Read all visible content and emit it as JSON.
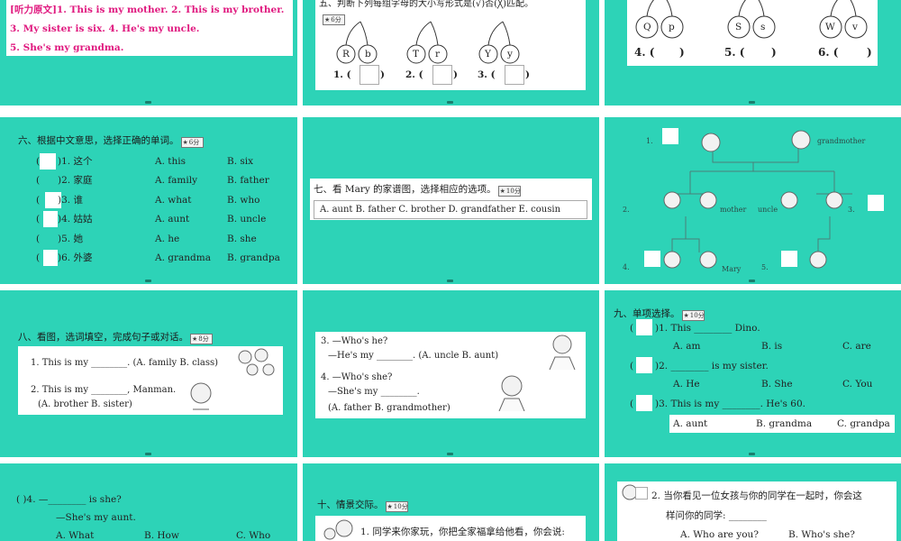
{
  "s1": {
    "lines": [
      "[听力原文]1. This is my mother.   2. This is my brother.",
      "3. My sister is six.   4. He's my uncle.",
      "5. She's my grandma."
    ]
  },
  "s2": {
    "instruction": "五、判断下列每组字母的大小写形式是(√)否(╳)匹配。",
    "badge": "6分",
    "pairs": [
      [
        "R",
        "b"
      ],
      [
        "T",
        "r"
      ],
      [
        "Y",
        "y"
      ]
    ],
    "answers": [
      "1. (",
      "2. (",
      "3. ("
    ],
    "close": ")"
  },
  "s3": {
    "pairs": [
      [
        "Q",
        "p"
      ],
      [
        "S",
        "s"
      ],
      [
        "W",
        "v"
      ]
    ],
    "answers": [
      "4. (",
      "5. (",
      "6. ("
    ],
    "close": ")"
  },
  "s4": {
    "instruction": "六、根据中文意思，选择正确的单词。",
    "badge": "6分",
    "rows": [
      {
        "num": ")1. 这个",
        "a": "A. this",
        "b": "B. six"
      },
      {
        "num": ")2. 家庭",
        "a": "A. family",
        "b": "B. father"
      },
      {
        "num": ")3. 谁",
        "a": "A. what",
        "b": "B. who"
      },
      {
        "num": ")4. 姑姑",
        "a": "A. aunt",
        "b": "B. uncle"
      },
      {
        "num": ")5. 她",
        "a": "A. he",
        "b": "B. she"
      },
      {
        "num": ")6. 外婆",
        "a": "A. grandma",
        "b": "B. grandpa"
      }
    ]
  },
  "s5": {
    "instruction": "七、看 Mary 的家谱图，选择相应的选项。",
    "badge": "10分",
    "options": "A. aunt   B. father   C. brother   D. grandfather   E. cousin"
  },
  "s6": {
    "labels": [
      "1.",
      "grandmother",
      "2.",
      "mother",
      "uncle",
      "3.",
      "4.",
      "Mary",
      "5."
    ]
  },
  "s7": {
    "instruction": "八、看图，选词填空，完成句子或对话。",
    "badge": "8分",
    "q1": "1. This is my ________. (A. family   B. class)",
    "q2": "2. This is my ________, Manman.",
    "q2opt": "(A. brother   B. sister)"
  },
  "s8": {
    "q3a": "3. —Who's he?",
    "q3b": "—He's my ________. (A. uncle   B. aunt)",
    "q4a": "4. —Who's she?",
    "q4b": "—She's my ________.",
    "q4opt": "(A. father   B. grandmother)"
  },
  "s9": {
    "instruction": "九、单项选择。",
    "badge": "10分",
    "q1": ")1. This ________ Dino.",
    "q1opts": [
      "A. am",
      "B. is",
      "C. are"
    ],
    "q2": ")2. ________ is my sister.",
    "q2opts": [
      "A. He",
      "B. She",
      "C. You"
    ],
    "q3": ")3. This is my ________. He's 60.",
    "q3opts": [
      "A. aunt",
      "B. grandma",
      "C. grandpa"
    ]
  },
  "s10": {
    "q4": "(    )4. —________ is she?",
    "q4b": "—She's my aunt.",
    "q4opts": [
      "A. What",
      "B. How",
      "C. Who"
    ]
  },
  "s11": {
    "instruction": "十、情景交际。",
    "badge": "10分",
    "q1": "1. 同学来你家玩，你把全家福拿给他看，你会说:"
  },
  "s12": {
    "q2": "2. 当你看见一位女孩与你的同学在一起时，你会这",
    "q2b": "样问你的同学: ________",
    "q2opts": [
      "A. Who are you?",
      "B. Who's she?"
    ]
  }
}
